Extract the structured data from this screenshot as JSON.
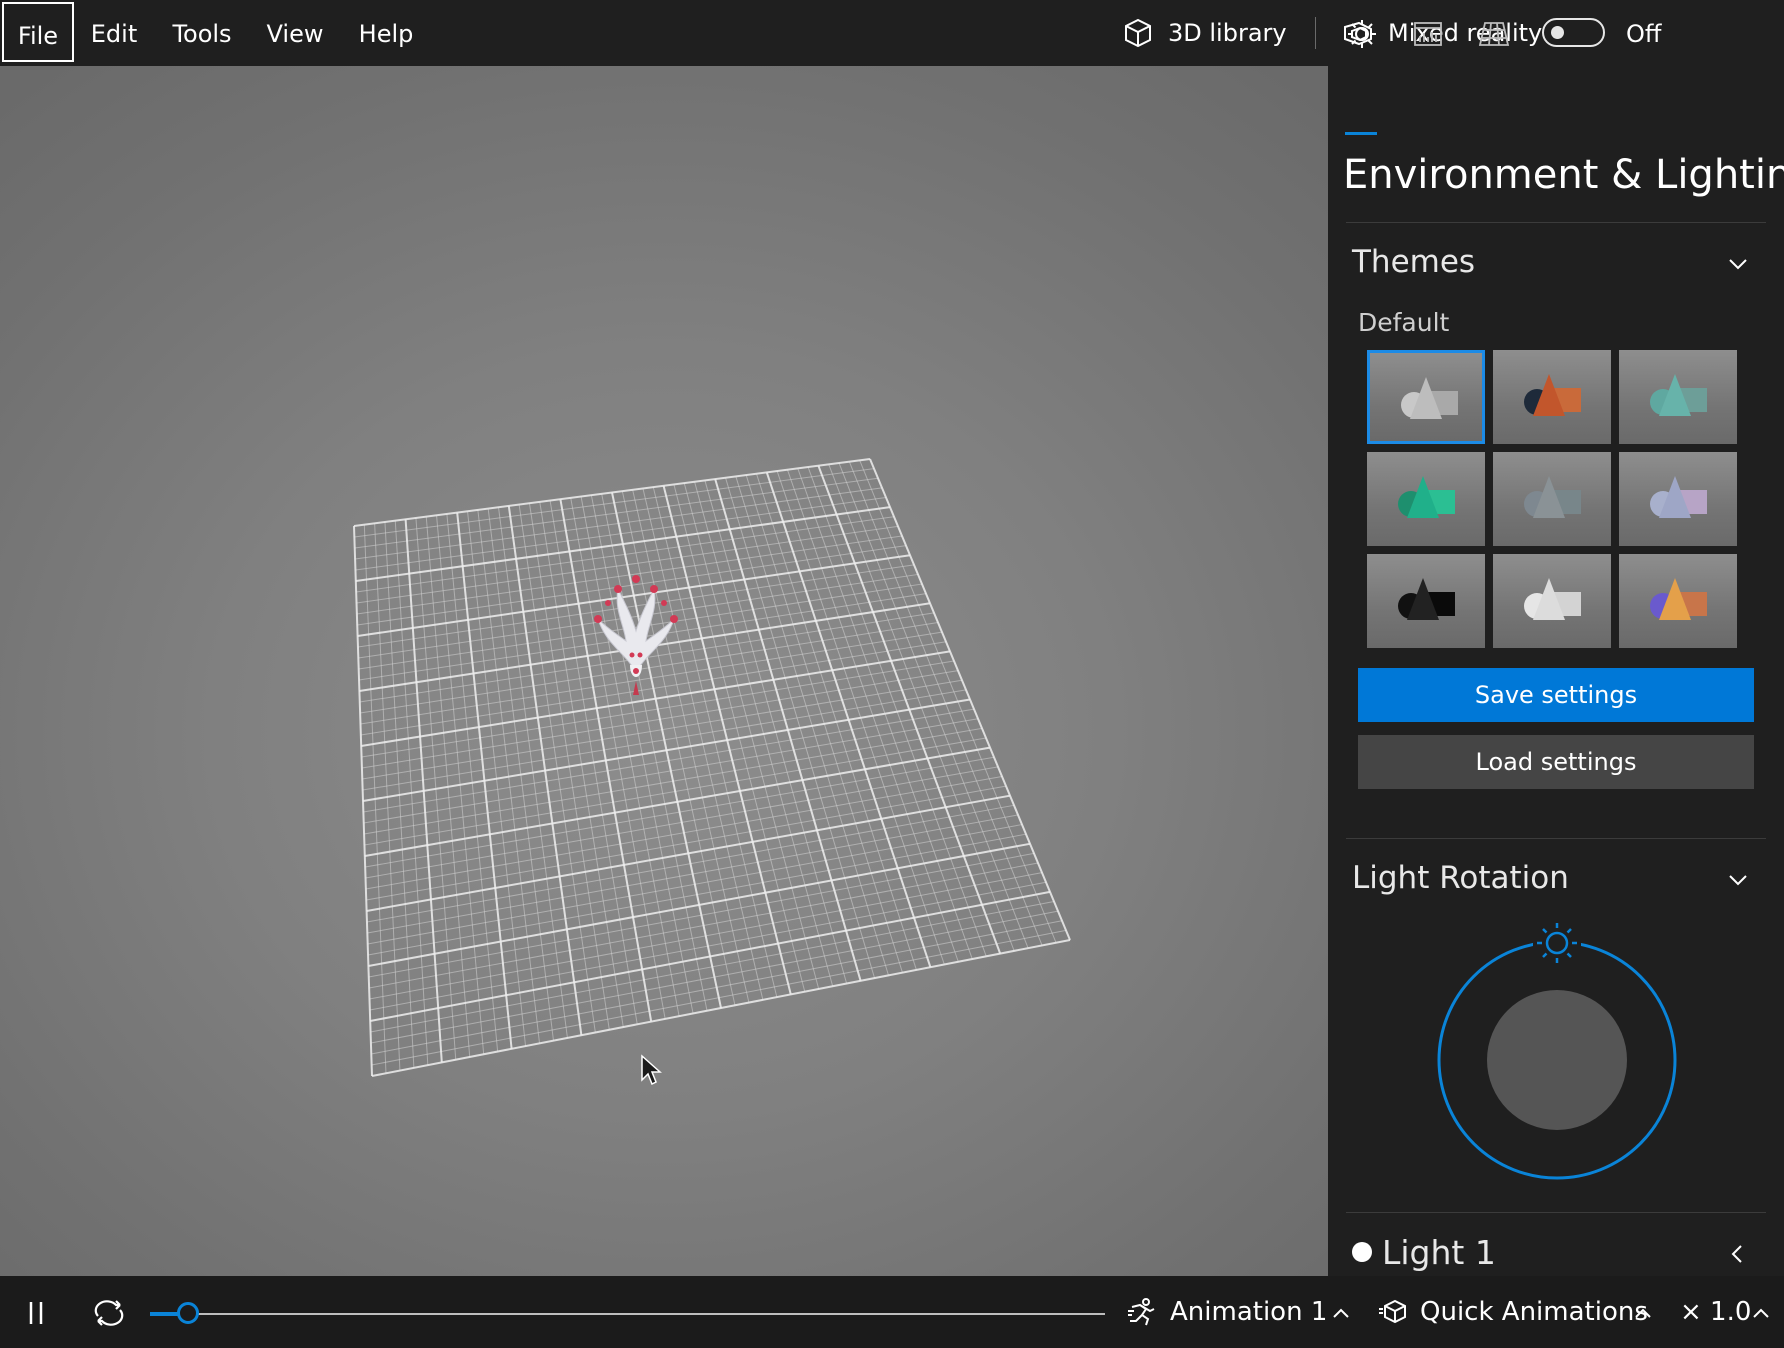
{
  "menu": {
    "file": "File",
    "edit": "Edit",
    "tools": "Tools",
    "view": "View",
    "help": "Help"
  },
  "topbar": {
    "library_label": "3D library",
    "library_icon": "cube-icon",
    "mixed_reality_label": "Mixed reality",
    "mixed_reality_icon": "mixed-reality-icon",
    "mixed_reality_state": "Off",
    "mixed_reality_on": false
  },
  "panel": {
    "tabs": [
      {
        "name": "environment-lighting",
        "icon": "sun-icon",
        "active": true
      },
      {
        "name": "stats-shading",
        "icon": "stats-icon",
        "active": false
      },
      {
        "name": "mesh-grid",
        "icon": "grid-icon",
        "active": false
      }
    ],
    "title": "Environment & Lighting",
    "themes": {
      "title": "Themes",
      "subtitle": "Default",
      "selected_index": 0,
      "tiles": [
        {
          "palette": [
            "#c8c8c8",
            "#bdbdbd",
            "#a9a9a9"
          ]
        },
        {
          "palette": [
            "#1e2a3a",
            "#c2562c",
            "#c96a3a"
          ]
        },
        {
          "palette": [
            "#5fa8a0",
            "#67b3aa",
            "#6d9e98"
          ]
        },
        {
          "palette": [
            "#1e8f6e",
            "#20b08a",
            "#2bbf93"
          ]
        },
        {
          "palette": [
            "#7e8890",
            "#8a9296",
            "#78868a"
          ]
        },
        {
          "palette": [
            "#a8b0cc",
            "#9ea6c6",
            "#b7a4c6"
          ]
        },
        {
          "palette": [
            "#111111",
            "#222222",
            "#0a0a0a"
          ]
        },
        {
          "palette": [
            "#e6e6e6",
            "#dcdcdc",
            "#d3d3d3"
          ]
        },
        {
          "palette": [
            "#6a5acd",
            "#e4a04a",
            "#c8754a"
          ]
        }
      ]
    },
    "save_label": "Save settings",
    "load_label": "Load settings",
    "light_rotation": {
      "title": "Light Rotation",
      "accent": "#0a84d8"
    },
    "light1_label": "Light 1"
  },
  "bottombar": {
    "timeline_progress": 0.04,
    "animation_label": "Animation 1",
    "animation_icon": "running-figure-icon",
    "quick_label": "Quick Animations",
    "quick_icon": "cube-icon",
    "speed_label": "× 1.0"
  }
}
